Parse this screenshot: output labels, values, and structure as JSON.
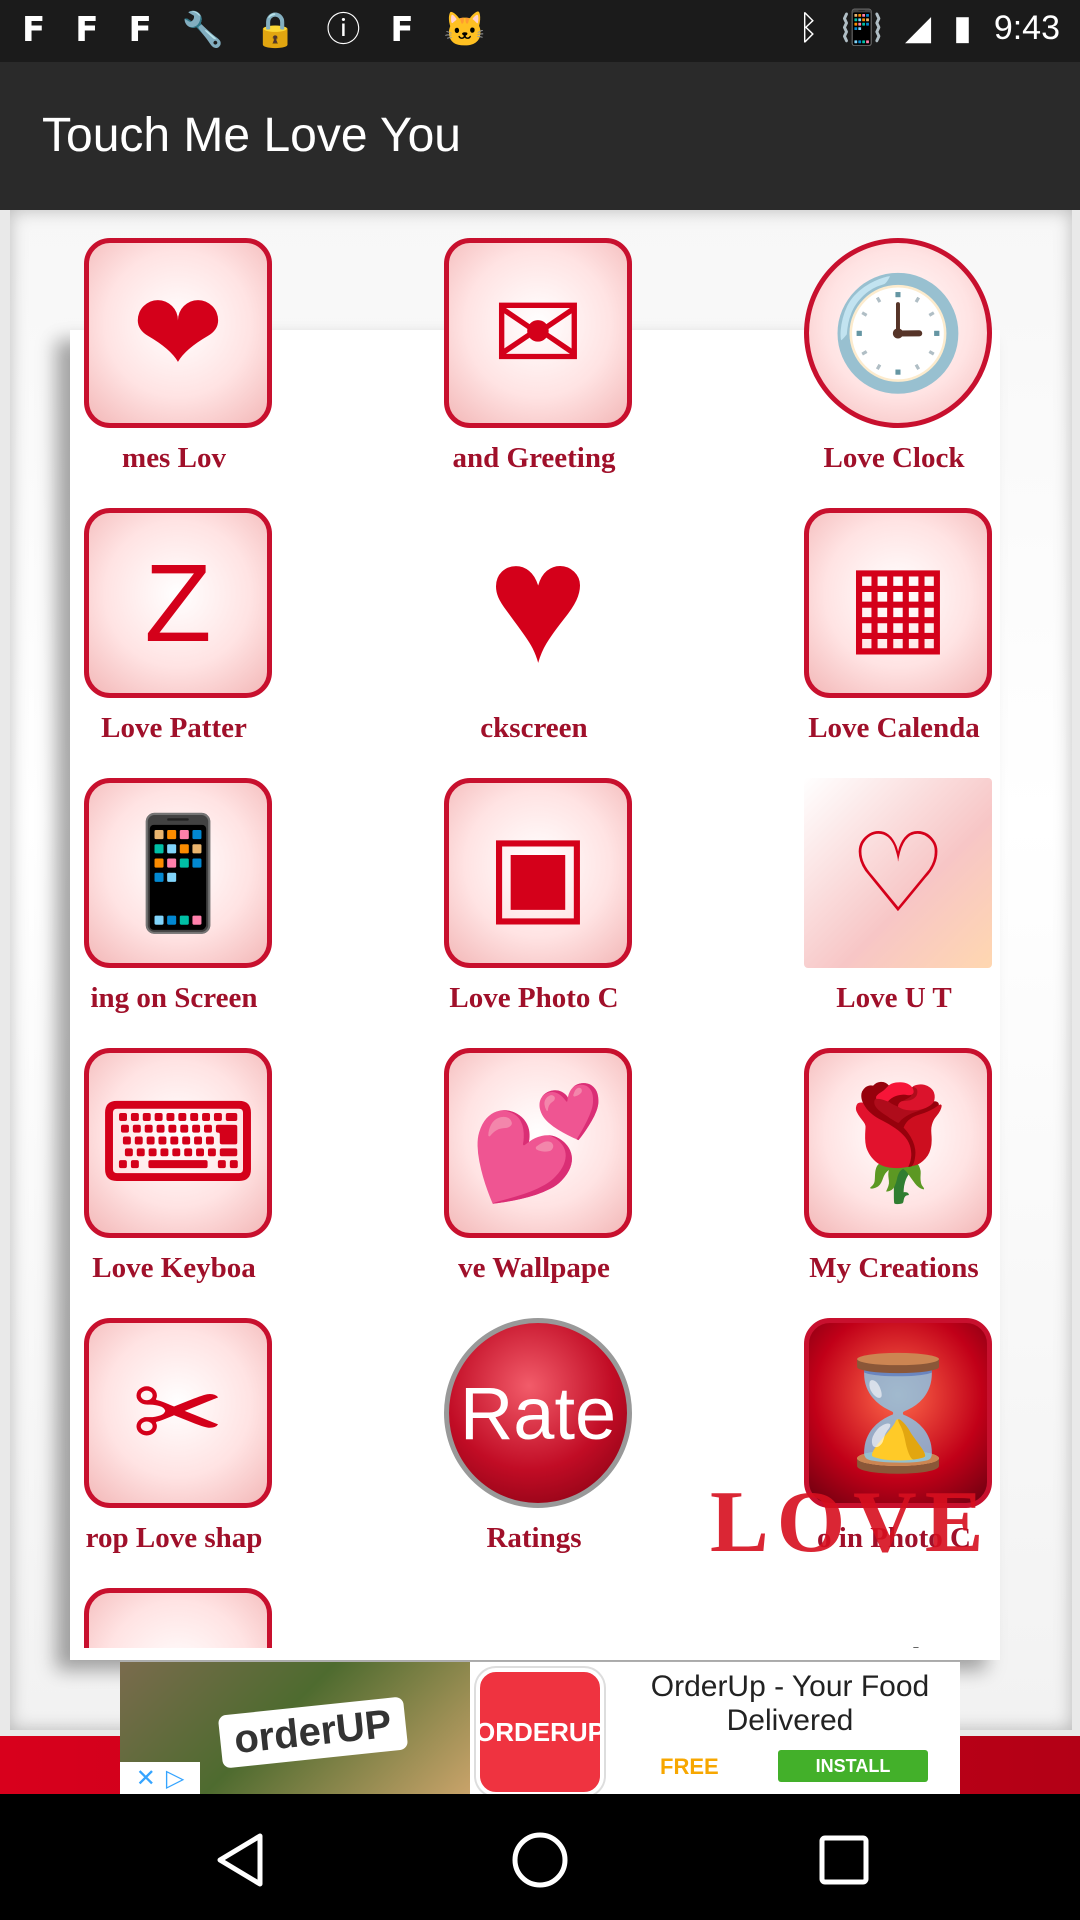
{
  "status_bar": {
    "time": "9:43",
    "left_icons": [
      "app-f-icon",
      "app-f-icon",
      "app-f-icon",
      "wrench-icon",
      "lock-icon",
      "info-circle-icon",
      "app-f-icon",
      "cat-icon"
    ],
    "right_icons": [
      "bluetooth-icon",
      "vibrate-icon",
      "signal-icon",
      "battery-icon"
    ]
  },
  "app_bar": {
    "title": "Touch Me Love You"
  },
  "grid": {
    "items": [
      {
        "label": "mes        Lov",
        "icon": "couple-frame-icon",
        "glyph": "❤"
      },
      {
        "label": "and Greeting",
        "icon": "love-letter-icon",
        "glyph": "✉"
      },
      {
        "label": "Love Clock",
        "icon": "love-clock-icon",
        "glyph": "🕒"
      },
      {
        "label": "Love Patter",
        "icon": "love-pattern-icon",
        "glyph": "Z"
      },
      {
        "label": "ckscreen",
        "icon": "heart-zipper-icon",
        "glyph": "♥"
      },
      {
        "label": "Love Calenda",
        "icon": "calendar-icon",
        "glyph": "▦"
      },
      {
        "label": "ing on Screen",
        "icon": "phone-hearts-icon",
        "glyph": "📱"
      },
      {
        "label": "Love Photo C",
        "icon": "parrot-collage-icon",
        "glyph": "▣"
      },
      {
        "label": "Love U        T",
        "icon": "love-u-icon",
        "glyph": "♡"
      },
      {
        "label": "Love Keyboa",
        "icon": "love-keyboard-icon",
        "glyph": "⌨"
      },
      {
        "label": "ve Wallpape",
        "icon": "love-wallpaper-icon",
        "glyph": "💕"
      },
      {
        "label": "My Creations",
        "icon": "rose-hand-icon",
        "glyph": "🌹"
      },
      {
        "label": "rop Love shap",
        "icon": "crop-shapes-icon",
        "glyph": "✂"
      },
      {
        "label": "Ratings",
        "icon": "rate-icon",
        "glyph": "Rate"
      },
      {
        "label": "o in Photo C",
        "icon": "hourglass-icon",
        "glyph": "⌛"
      }
    ],
    "partial_row_icons": [
      "heart-tile-icon",
      "santa-heart-icon",
      "guitar-icon"
    ],
    "watermark": "LOVE"
  },
  "ad": {
    "logo_text": "orderUP",
    "icon_text": "ORDERUP",
    "title": "OrderUp - Your Food Delivered",
    "free_label": "FREE",
    "install_label": "INSTALL"
  },
  "nav_bar": {
    "buttons": [
      "back-icon",
      "home-icon",
      "recents-icon"
    ]
  }
}
